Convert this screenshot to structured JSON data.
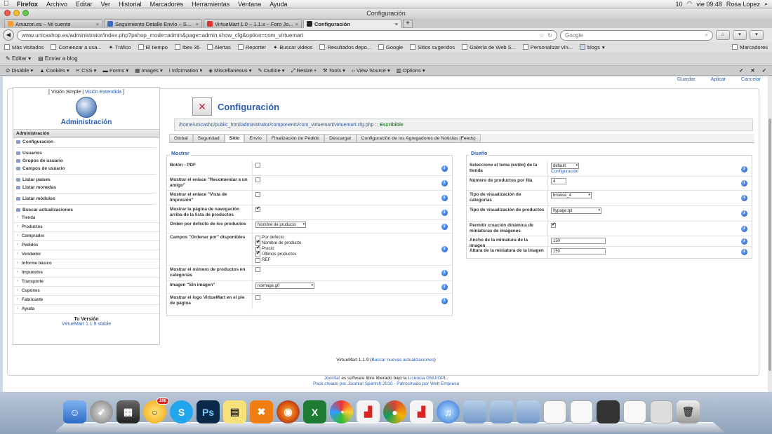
{
  "mac_menubar": {
    "app": "Firefox",
    "items": [
      "Archivo",
      "Editar",
      "Ver",
      "Historial",
      "Marcadores",
      "Herramientas",
      "Ventana",
      "Ayuda"
    ],
    "status_number": "10",
    "clock": "vie 09:48",
    "user": "Rosa Lopez"
  },
  "window": {
    "title": "Configuración"
  },
  "browser_tabs": [
    {
      "label": "Amazon.es – Mi cuenta"
    },
    {
      "label": "Seguimiento Detalle Envío – SE..."
    },
    {
      "label": "VirtueMart 1.0 – 1.1.x – Foro Jo..."
    },
    {
      "label": "Configuración"
    }
  ],
  "navbar": {
    "url": "www.unicashop.es/administrator/index.php?pshop_mode=admin&page=admin.show_cfg&option=com_virtuemart",
    "search_placeholder": "Google"
  },
  "bookmarks": {
    "items": [
      "Más visitados",
      "Comenzar a usa...",
      "Tráfico",
      "El tiempo",
      "Ibex 35",
      "Alertas",
      "Reporter",
      "Buscar videos",
      "Resultados depo...",
      "Google",
      "Sitios sugeridos",
      "Galería de Web S...",
      "Personalizar vín...",
      "blogs"
    ],
    "right": "Marcadores"
  },
  "edit_toolbar": {
    "edit": "Editar",
    "send": "Enviar a blog"
  },
  "dev_toolbar": {
    "items": [
      "Disable",
      "Cookies",
      "CSS",
      "Forms",
      "Images",
      "Information",
      "Miscellaneous",
      "Outline",
      "Resize",
      "Tools",
      "View Source",
      "Options"
    ]
  },
  "top_actions": {
    "save": "Guardar",
    "apply": "Aplicar",
    "cancel": "Cancelar"
  },
  "left_menu": {
    "simple": "Visión Simple",
    "extended": "Visión Extendida",
    "logo_text": "VirtueMart",
    "title": "Administración",
    "section": "Administración",
    "items_a": [
      "Configuración"
    ],
    "items_b": [
      "Usuarios",
      "Grupos de usuario",
      "Campos de usuario"
    ],
    "items_c": [
      "Listar países",
      "Listar monedas"
    ],
    "items_d": [
      "Listar módulos"
    ],
    "items_e": [
      "Buscar actualizaciones"
    ],
    "groups": [
      "Tienda",
      "Productos",
      "Comprador",
      "Pedidos",
      "Vendedor",
      "Informe básico",
      "Impuestos",
      "Transporte",
      "Cupones",
      "Fabricante",
      "Ayuda"
    ],
    "version_title": "Tu Versión",
    "version": "VirtueMart 1.1.9 stable"
  },
  "content": {
    "title": "Configuración",
    "path": "/home/unicasho/public_html/administrator/components/com_virtuemart/virtuemart.cfg.php ::",
    "path_status": "Escribible",
    "tabs": [
      "Global",
      "Seguridad",
      "Sitio",
      "Envío",
      "Finalización de Pedido",
      "Descargar",
      "Configuración de los Agregadores de Noticias (Feeds)"
    ],
    "active_tab": "Sitio",
    "mostrar": {
      "title": "Mostrar",
      "rows": [
        {
          "label": "Botón - PDF",
          "type": "checkbox",
          "checked": false
        },
        {
          "label": "Mostrar el enlace \"Recomendar a un amigo\"",
          "type": "checkbox",
          "checked": false
        },
        {
          "label": "Mostrar el enlace \"Vista de Impresión\"",
          "type": "checkbox",
          "checked": false
        },
        {
          "label": "Mostrar la página de navegación arriba de la lista de productos",
          "type": "checkbox",
          "checked": true
        },
        {
          "label": "Orden por defecto de los productos",
          "type": "select",
          "value": "Nombre de producto"
        },
        {
          "label": "Campos \"Ordenar por\" disponibles",
          "type": "checklist",
          "options": [
            {
              "label": "Por defecto",
              "checked": false
            },
            {
              "label": "Nombre de producto",
              "checked": true
            },
            {
              "label": "Precio",
              "checked": true
            },
            {
              "label": "Últimos productos",
              "checked": true
            },
            {
              "label": "REF",
              "checked": false
            }
          ]
        },
        {
          "label": "Mostrar el número de productos en categorías",
          "type": "checkbox",
          "checked": false
        },
        {
          "label": "Imagen \"Sin imagen\"",
          "type": "select",
          "value": "noimage.gif"
        },
        {
          "label": "Mostrar el logo VirtueMart en el pie de página",
          "type": "checkbox",
          "checked": false
        }
      ]
    },
    "diseno": {
      "title": "Diseño",
      "theme_label": "Seleccione el tema (estilo) de la tienda",
      "theme_value": "default",
      "theme_link": "Configuración",
      "per_row_label": "Número de productos por fila",
      "per_row_value": "4",
      "cat_view_label": "Tipo de visualización de categorías",
      "cat_view_value": "browse_4",
      "prod_view_label": "Tipo de visualización de productos",
      "prod_view_value": "flypage.tpl",
      "thumbs_label": "Permitir creación dinámica de miniaturas de imágenes",
      "thumbs_checked": true,
      "thumb_w_label": "Ancho de la miniatura de la imagen",
      "thumb_w_value": "150",
      "thumb_h_label": "Altura de la miniatura de la imagen",
      "thumb_h_value": "150"
    }
  },
  "footer": {
    "version": "VirtueMart 1.1.9",
    "update_link": "Buscar nuevas actualizaciones",
    "joomla": "Joomla!",
    "free_text": "es software libre liberado bajo la",
    "license": "Licencia GNU/GPL.",
    "pack": "Pack creado por Joomla! Spanish 2010 - Patrocinado por Web Empresa"
  },
  "dock": {
    "badge": "286",
    "icons": [
      "finder-icon",
      "rocket-icon",
      "calculator-icon",
      "clock-icon",
      "skype-icon",
      "photoshop-icon",
      "stickies-icon",
      "xampp-icon",
      "firefox-icon",
      "excel-icon",
      "picasa-icon",
      "pdf-icon",
      "chrome-icon",
      "acrobat-icon",
      "itunes-icon",
      "folder-icon",
      "folder-icon",
      "folder-icon",
      "document-icon",
      "document-icon",
      "window-icon",
      "document-icon",
      "window-icon",
      "trash-icon"
    ]
  },
  "colors": {
    "accent": "#2a5db0",
    "ok": "#2c8a2c"
  }
}
